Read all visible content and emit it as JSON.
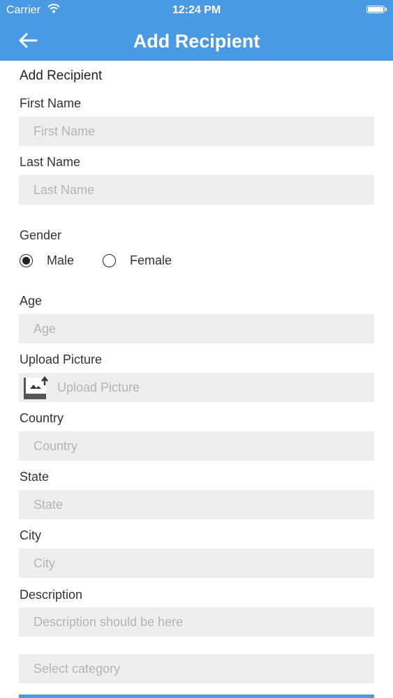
{
  "status_bar": {
    "carrier": "Carrier",
    "time": "12:24 PM"
  },
  "nav": {
    "title": "Add Recipient"
  },
  "form": {
    "section_title": "Add Recipient",
    "first_name": {
      "label": "First Name",
      "placeholder": "First Name"
    },
    "last_name": {
      "label": "Last Name",
      "placeholder": "Last Name"
    },
    "gender": {
      "label": "Gender",
      "options": [
        "Male",
        "Female"
      ],
      "selected": "Male"
    },
    "age": {
      "label": "Age",
      "placeholder": "Age"
    },
    "upload_picture": {
      "label": "Upload Picture",
      "placeholder": "Upload Picture"
    },
    "country": {
      "label": "Country",
      "placeholder": "Country"
    },
    "state": {
      "label": "State",
      "placeholder": "State"
    },
    "city": {
      "label": "City",
      "placeholder": "City"
    },
    "description": {
      "label": "Description",
      "placeholder": "Description should be here"
    },
    "category": {
      "placeholder": "Select category"
    }
  },
  "colors": {
    "accent": "#4a9ae3",
    "field_bg": "#eeeeef",
    "placeholder": "#b4b4b8"
  }
}
